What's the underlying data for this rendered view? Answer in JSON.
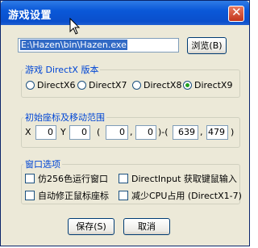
{
  "window": {
    "title": "游戏设置"
  },
  "path": {
    "value": "E:\\Hazen\\bin\\Hazen.exe",
    "browse_label": "浏览(B)"
  },
  "directx": {
    "group_label": "游戏 DirectX 版本",
    "options": [
      "DirectX6",
      "DirectX7",
      "DirectX8",
      "DirectX9"
    ],
    "selected": "DirectX9"
  },
  "coords": {
    "group_label": "初始座标及移动范围",
    "x_label": "X",
    "x": "0",
    "y_label": "Y",
    "y": "0",
    "open_paren": "(",
    "comma": ",",
    "range_sep": ")-(",
    "close_paren": ")",
    "r1": "0",
    "r2": "0",
    "r3": "639",
    "r4": "479"
  },
  "options": {
    "group_label": "窗口选项",
    "items": [
      {
        "label": "仿256色运行窗口",
        "checked": false
      },
      {
        "label": "DirectInput 获取键鼠输入",
        "checked": false
      },
      {
        "label": "自动修正鼠标座标",
        "checked": false
      },
      {
        "label": "减少CPU占用 (DirectX1-7)",
        "checked": false
      }
    ]
  },
  "buttons": {
    "save": "保存(S)",
    "cancel": "取消"
  }
}
